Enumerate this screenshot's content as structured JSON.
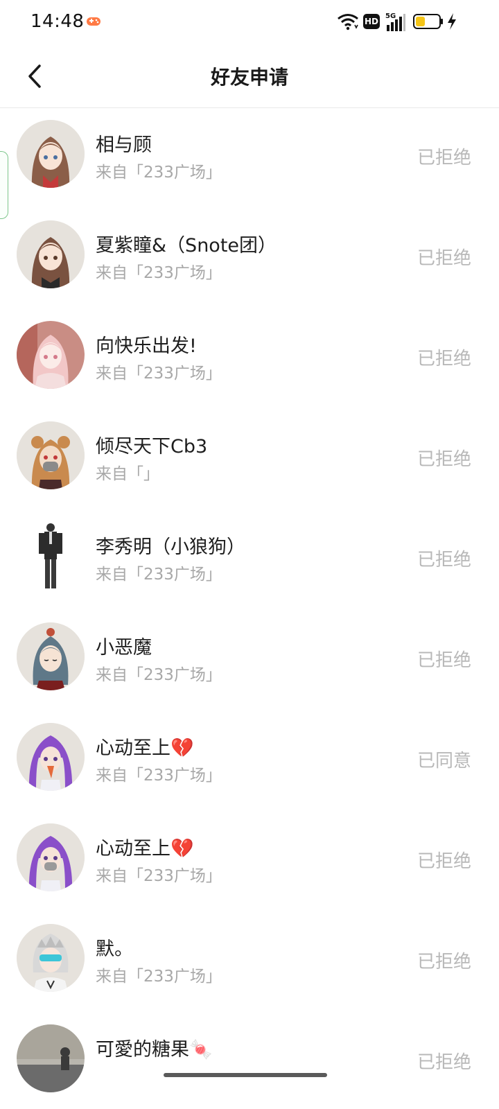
{
  "status_bar": {
    "time": "14:48",
    "icons": [
      "game-icon",
      "wifi-icon",
      "hd-icon",
      "signal-5g-icon",
      "battery-icon",
      "charging-bolt-icon"
    ],
    "hd_label": "HD",
    "network_label": "5G",
    "battery_color": "#f5c518"
  },
  "header": {
    "title": "好友申请",
    "back_icon": "chevron-left-icon"
  },
  "requests": [
    {
      "name": "相与顾",
      "source": "来自「233广场」",
      "status": "已拒绝",
      "avatar_hair": "#8b5e48"
    },
    {
      "name": "夏紫瞳&（Snote团）",
      "source": "来自「233广场」",
      "status": "已拒绝",
      "avatar_hair": "#7a5240"
    },
    {
      "name": "向快乐出发!",
      "source": "来自「233广场」",
      "status": "已拒绝",
      "avatar_hair": "#f2c7c7"
    },
    {
      "name": "倾尽天下Cb3",
      "source": "来自「」",
      "status": "已拒绝",
      "avatar_hair": "#c98a4e"
    },
    {
      "name": "李秀明（小狼狗）",
      "source": "来自「233广场」",
      "status": "已拒绝",
      "avatar_hair": "#333333"
    },
    {
      "name": "小恶魔",
      "source": "来自「233广场」",
      "status": "已拒绝",
      "avatar_hair": "#5f7888"
    },
    {
      "name": "心动至上💔",
      "source": "来自「233广场」",
      "status": "已同意",
      "avatar_hair": "#8a4fc9"
    },
    {
      "name": "心动至上💔",
      "source": "来自「233广场」",
      "status": "已拒绝",
      "avatar_hair": "#8a4fc9"
    },
    {
      "name": "默。",
      "source": "来自「233广场」",
      "status": "已拒绝",
      "avatar_hair": "#d8d8d8"
    },
    {
      "name": "可愛的糖果🍬",
      "source": "",
      "status": "已拒绝",
      "avatar_hair": "#6b6b6b"
    }
  ],
  "colors": {
    "status_text": "#b8b8b8",
    "source_text": "#a8a8a8",
    "side_tab_border": "#7cc58a"
  }
}
